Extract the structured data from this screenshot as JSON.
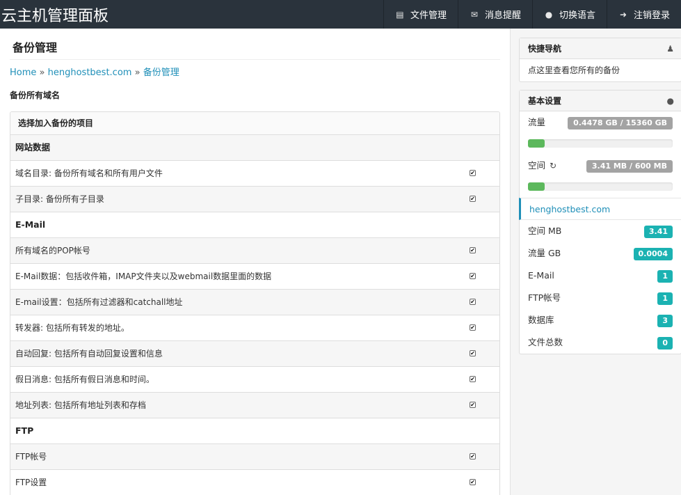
{
  "header": {
    "brand": "云主机管理面板",
    "nav": [
      {
        "label": "文件管理",
        "icon": "file-icon"
      },
      {
        "label": "消息提醒",
        "icon": "envelope-icon"
      },
      {
        "label": "切换语言",
        "icon": "globe-icon"
      },
      {
        "label": "注销登录",
        "icon": "logout-icon"
      }
    ]
  },
  "main": {
    "title": "备份管理",
    "breadcrumb": {
      "home": "Home",
      "sep": "»",
      "domain": "henghostbest.com",
      "current": "备份管理"
    },
    "section_label": "备份所有域名",
    "panel_title": "选择加入备份的项目",
    "rows": [
      {
        "label": "网站数据",
        "type": "group"
      },
      {
        "label": "域名目录: 备份所有域名和所有用户文件",
        "type": "item",
        "checked": true
      },
      {
        "label": "子目录: 备份所有子目录",
        "type": "item",
        "checked": true
      },
      {
        "label": "E-Mail",
        "type": "group"
      },
      {
        "label": "所有域名的POP帐号",
        "type": "item",
        "checked": true
      },
      {
        "label": "E-Mail数据：包括收件箱，IMAP文件夹以及webmail数据里面的数据",
        "type": "item",
        "checked": true
      },
      {
        "label": "E-mail设置：包括所有过滤器和catchall地址",
        "type": "item",
        "checked": true
      },
      {
        "label": "转发器: 包括所有转发的地址。",
        "type": "item",
        "checked": true
      },
      {
        "label": "自动回复: 包括所有自动回复设置和信息",
        "type": "item",
        "checked": true
      },
      {
        "label": "假日消息: 包括所有假日消息和时间。",
        "type": "item",
        "checked": true
      },
      {
        "label": "地址列表: 包括所有地址列表和存档",
        "type": "item",
        "checked": true
      },
      {
        "label": "FTP",
        "type": "group"
      },
      {
        "label": "FTP帐号",
        "type": "item",
        "checked": true
      },
      {
        "label": "FTP设置",
        "type": "item",
        "checked": true
      }
    ]
  },
  "sidebar": {
    "quicknav": {
      "title": "快捷导航",
      "icon": "user-icon",
      "text": "点这里查看您所有的备份"
    },
    "settings": {
      "title": "基本设置",
      "icon": "globe-icon",
      "traffic_label": "流量",
      "traffic_value": "0.4478 GB / 15360 GB",
      "traffic_fraction": 3e-05,
      "space_label": "空间",
      "space_value": "3.41 MB / 600 MB",
      "space_fraction": 0.0057,
      "domain": "henghostbest.com",
      "stats": [
        {
          "label": "空间 MB",
          "value": "3.41"
        },
        {
          "label": "流量 GB",
          "value": "0.0004"
        },
        {
          "label": "E-Mail",
          "value": "1"
        },
        {
          "label": "FTP帐号",
          "value": "1"
        },
        {
          "label": "数据库",
          "value": "3"
        },
        {
          "label": "文件总数",
          "value": "0"
        }
      ]
    }
  },
  "colors": {
    "topbar": "#2a333c",
    "link": "#1f8fb8",
    "badge": "#1bb2b2",
    "progress": "#5cb85c",
    "gray_badge": "#a3a3a3"
  }
}
